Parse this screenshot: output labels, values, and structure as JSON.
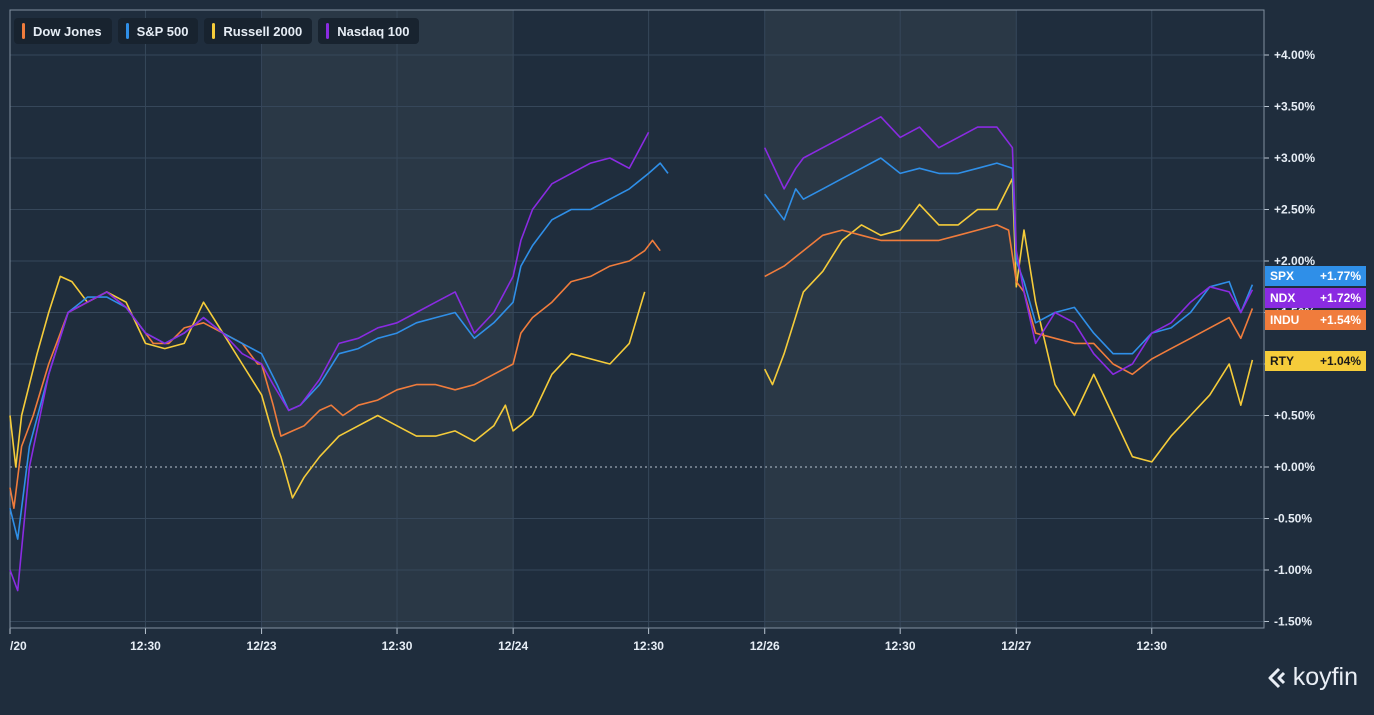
{
  "chart_data": {
    "type": "line",
    "title": "",
    "xlabel": "",
    "ylabel": "",
    "ylim": [
      -1.5,
      4.0
    ],
    "y_ticks": [
      "+4.00%",
      "+3.50%",
      "+3.00%",
      "+2.50%",
      "+2.00%",
      "+1.50%",
      "+1.00%",
      "+0.50%",
      "+0.00%",
      "-0.50%",
      "-1.00%",
      "-1.50%"
    ],
    "x_ticks": [
      "/20",
      "12:30",
      "12/23",
      "12:30",
      "12/24",
      "12:30",
      "12/26",
      "12:30",
      "12/27",
      "12:30"
    ],
    "grid": true,
    "zero_line": true,
    "legend_position": "top-left",
    "x_note": "x values are hours of trading since the start of the 12/20 session; sessions start at 0, 6.5, 13, 19.5, 26 (12/20, 12/23, 12/24, 12/26, 12/27)",
    "series": [
      {
        "name": "Dow Jones",
        "ticker": "INDU",
        "last": "+1.54%",
        "color": "#f07c3c",
        "points": [
          [
            0,
            -0.2
          ],
          [
            0.1,
            -0.4
          ],
          [
            0.3,
            0.2
          ],
          [
            0.6,
            0.5
          ],
          [
            1,
            1.0
          ],
          [
            1.5,
            1.5
          ],
          [
            2,
            1.6
          ],
          [
            2.5,
            1.7
          ],
          [
            3,
            1.55
          ],
          [
            3.3,
            1.4
          ],
          [
            3.7,
            1.2
          ],
          [
            4.1,
            1.2
          ],
          [
            4.5,
            1.35
          ],
          [
            5,
            1.4
          ],
          [
            5.5,
            1.3
          ],
          [
            6,
            1.2
          ],
          [
            6.4,
            1.0
          ],
          [
            6.5,
            1.0
          ],
          [
            6.8,
            0.6
          ],
          [
            7,
            0.3
          ],
          [
            7.3,
            0.35
          ],
          [
            7.6,
            0.4
          ],
          [
            8,
            0.55
          ],
          [
            8.3,
            0.6
          ],
          [
            8.6,
            0.5
          ],
          [
            9,
            0.6
          ],
          [
            9.5,
            0.65
          ],
          [
            10,
            0.75
          ],
          [
            10.5,
            0.8
          ],
          [
            11,
            0.8
          ],
          [
            11.5,
            0.75
          ],
          [
            12,
            0.8
          ],
          [
            12.5,
            0.9
          ],
          [
            13,
            1.0
          ],
          [
            13.2,
            1.3
          ],
          [
            13.5,
            1.45
          ],
          [
            14,
            1.6
          ],
          [
            14.5,
            1.8
          ],
          [
            15,
            1.85
          ],
          [
            15.5,
            1.95
          ],
          [
            16,
            2.0
          ],
          [
            16.4,
            2.1
          ],
          [
            16.6,
            2.2
          ],
          [
            16.8,
            2.1
          ],
          [
            19.5,
            2.1
          ],
          [
            19.5,
            1.85
          ],
          [
            20,
            1.95
          ],
          [
            20.5,
            2.1
          ],
          [
            21,
            2.25
          ],
          [
            21.5,
            2.3
          ],
          [
            22,
            2.25
          ],
          [
            22.5,
            2.2
          ],
          [
            23,
            2.2
          ],
          [
            23.5,
            2.2
          ],
          [
            24,
            2.2
          ],
          [
            24.5,
            2.25
          ],
          [
            25,
            2.3
          ],
          [
            25.5,
            2.35
          ],
          [
            25.8,
            2.3
          ],
          [
            26,
            1.8
          ],
          [
            26.2,
            1.7
          ],
          [
            26.5,
            1.3
          ],
          [
            27,
            1.25
          ],
          [
            27.5,
            1.2
          ],
          [
            28,
            1.2
          ],
          [
            28.5,
            1.0
          ],
          [
            29,
            0.9
          ],
          [
            29.5,
            1.05
          ],
          [
            30,
            1.15
          ],
          [
            30.5,
            1.25
          ],
          [
            31,
            1.35
          ],
          [
            31.5,
            1.45
          ],
          [
            31.8,
            1.25
          ],
          [
            32.1,
            1.54
          ]
        ]
      },
      {
        "name": "S&P 500",
        "ticker": "SPX",
        "last": "+1.77%",
        "color": "#2f8fe8",
        "points": [
          [
            0,
            -0.4
          ],
          [
            0.2,
            -0.7
          ],
          [
            0.5,
            0.2
          ],
          [
            1,
            0.9
          ],
          [
            1.5,
            1.5
          ],
          [
            2,
            1.65
          ],
          [
            2.5,
            1.65
          ],
          [
            3,
            1.55
          ],
          [
            3.5,
            1.3
          ],
          [
            4,
            1.2
          ],
          [
            4.5,
            1.3
          ],
          [
            5,
            1.45
          ],
          [
            5.5,
            1.3
          ],
          [
            6,
            1.2
          ],
          [
            6.5,
            1.1
          ],
          [
            6.9,
            0.8
          ],
          [
            7.2,
            0.55
          ],
          [
            7.5,
            0.6
          ],
          [
            8,
            0.8
          ],
          [
            8.5,
            1.1
          ],
          [
            9,
            1.15
          ],
          [
            9.5,
            1.25
          ],
          [
            10,
            1.3
          ],
          [
            10.5,
            1.4
          ],
          [
            11,
            1.45
          ],
          [
            11.5,
            1.5
          ],
          [
            12,
            1.25
          ],
          [
            12.5,
            1.4
          ],
          [
            13,
            1.6
          ],
          [
            13.2,
            1.95
          ],
          [
            13.5,
            2.15
          ],
          [
            14,
            2.4
          ],
          [
            14.5,
            2.5
          ],
          [
            15,
            2.5
          ],
          [
            15.5,
            2.6
          ],
          [
            16,
            2.7
          ],
          [
            16.5,
            2.85
          ],
          [
            16.8,
            2.95
          ],
          [
            17,
            2.85
          ],
          [
            19.5,
            2.85
          ],
          [
            19.5,
            2.65
          ],
          [
            20,
            2.4
          ],
          [
            20.3,
            2.7
          ],
          [
            20.5,
            2.6
          ],
          [
            21,
            2.7
          ],
          [
            21.5,
            2.8
          ],
          [
            22,
            2.9
          ],
          [
            22.5,
            3.0
          ],
          [
            23,
            2.85
          ],
          [
            23.5,
            2.9
          ],
          [
            24,
            2.85
          ],
          [
            24.5,
            2.85
          ],
          [
            25,
            2.9
          ],
          [
            25.5,
            2.95
          ],
          [
            25.9,
            2.9
          ],
          [
            26,
            2.0
          ],
          [
            26.2,
            1.8
          ],
          [
            26.5,
            1.4
          ],
          [
            27,
            1.5
          ],
          [
            27.5,
            1.55
          ],
          [
            28,
            1.3
          ],
          [
            28.5,
            1.1
          ],
          [
            29,
            1.1
          ],
          [
            29.5,
            1.3
          ],
          [
            30,
            1.35
          ],
          [
            30.5,
            1.5
          ],
          [
            31,
            1.75
          ],
          [
            31.5,
            1.8
          ],
          [
            31.8,
            1.5
          ],
          [
            32.1,
            1.77
          ]
        ]
      },
      {
        "name": "Russell 2000",
        "ticker": "RTY",
        "last": "+1.04%",
        "color": "#f5cc3a",
        "points": [
          [
            0,
            0.5
          ],
          [
            0.15,
            0.0
          ],
          [
            0.3,
            0.5
          ],
          [
            0.7,
            1.1
          ],
          [
            1,
            1.5
          ],
          [
            1.3,
            1.85
          ],
          [
            1.6,
            1.8
          ],
          [
            2,
            1.6
          ],
          [
            2.5,
            1.7
          ],
          [
            3,
            1.6
          ],
          [
            3.5,
            1.2
          ],
          [
            4,
            1.15
          ],
          [
            4.5,
            1.2
          ],
          [
            5,
            1.6
          ],
          [
            5.5,
            1.3
          ],
          [
            6,
            1.0
          ],
          [
            6.5,
            0.7
          ],
          [
            6.8,
            0.3
          ],
          [
            7,
            0.1
          ],
          [
            7.3,
            -0.3
          ],
          [
            7.6,
            -0.1
          ],
          [
            8,
            0.1
          ],
          [
            8.5,
            0.3
          ],
          [
            9,
            0.4
          ],
          [
            9.5,
            0.5
          ],
          [
            10,
            0.4
          ],
          [
            10.5,
            0.3
          ],
          [
            11,
            0.3
          ],
          [
            11.5,
            0.35
          ],
          [
            12,
            0.25
          ],
          [
            12.5,
            0.4
          ],
          [
            12.8,
            0.6
          ],
          [
            13,
            0.35
          ],
          [
            13.5,
            0.5
          ],
          [
            14,
            0.9
          ],
          [
            14.5,
            1.1
          ],
          [
            15,
            1.05
          ],
          [
            15.5,
            1.0
          ],
          [
            16,
            1.2
          ],
          [
            16.4,
            1.7
          ],
          [
            19.5,
            0.95
          ],
          [
            19.7,
            0.8
          ],
          [
            20,
            1.1
          ],
          [
            20.5,
            1.7
          ],
          [
            21,
            1.9
          ],
          [
            21.5,
            2.2
          ],
          [
            22,
            2.35
          ],
          [
            22.5,
            2.25
          ],
          [
            23,
            2.3
          ],
          [
            23.5,
            2.55
          ],
          [
            24,
            2.35
          ],
          [
            24.5,
            2.35
          ],
          [
            25,
            2.5
          ],
          [
            25.5,
            2.5
          ],
          [
            25.9,
            2.8
          ],
          [
            26,
            1.75
          ],
          [
            26.2,
            2.3
          ],
          [
            26.5,
            1.6
          ],
          [
            27,
            0.8
          ],
          [
            27.5,
            0.5
          ],
          [
            28,
            0.9
          ],
          [
            28.5,
            0.5
          ],
          [
            29,
            0.1
          ],
          [
            29.5,
            0.05
          ],
          [
            30,
            0.3
          ],
          [
            30.5,
            0.5
          ],
          [
            31,
            0.7
          ],
          [
            31.5,
            1.0
          ],
          [
            31.8,
            0.6
          ],
          [
            32.1,
            1.04
          ]
        ]
      },
      {
        "name": "Nasdaq 100",
        "ticker": "NDX",
        "last": "+1.72%",
        "color": "#8a2be2",
        "points": [
          [
            0,
            -1.0
          ],
          [
            0.2,
            -1.2
          ],
          [
            0.5,
            0.0
          ],
          [
            1,
            0.9
          ],
          [
            1.5,
            1.5
          ],
          [
            2,
            1.6
          ],
          [
            2.5,
            1.7
          ],
          [
            3,
            1.55
          ],
          [
            3.5,
            1.3
          ],
          [
            4,
            1.2
          ],
          [
            4.5,
            1.3
          ],
          [
            5,
            1.45
          ],
          [
            5.5,
            1.3
          ],
          [
            6,
            1.1
          ],
          [
            6.5,
            1.0
          ],
          [
            6.8,
            0.8
          ],
          [
            7.2,
            0.55
          ],
          [
            7.5,
            0.6
          ],
          [
            8,
            0.85
          ],
          [
            8.5,
            1.2
          ],
          [
            9,
            1.25
          ],
          [
            9.5,
            1.35
          ],
          [
            10,
            1.4
          ],
          [
            10.5,
            1.5
          ],
          [
            11,
            1.6
          ],
          [
            11.5,
            1.7
          ],
          [
            12,
            1.3
          ],
          [
            12.5,
            1.5
          ],
          [
            13,
            1.85
          ],
          [
            13.2,
            2.2
          ],
          [
            13.5,
            2.5
          ],
          [
            14,
            2.75
          ],
          [
            14.5,
            2.85
          ],
          [
            15,
            2.95
          ],
          [
            15.5,
            3.0
          ],
          [
            16,
            2.9
          ],
          [
            16.5,
            3.25
          ],
          [
            19.5,
            3.25
          ],
          [
            19.5,
            3.1
          ],
          [
            20,
            2.7
          ],
          [
            20.3,
            2.9
          ],
          [
            20.5,
            3.0
          ],
          [
            21,
            3.1
          ],
          [
            21.5,
            3.2
          ],
          [
            22,
            3.3
          ],
          [
            22.5,
            3.4
          ],
          [
            23,
            3.2
          ],
          [
            23.5,
            3.3
          ],
          [
            24,
            3.1
          ],
          [
            24.5,
            3.2
          ],
          [
            25,
            3.3
          ],
          [
            25.5,
            3.3
          ],
          [
            25.9,
            3.1
          ],
          [
            26,
            2.1
          ],
          [
            26.2,
            1.7
          ],
          [
            26.5,
            1.2
          ],
          [
            27,
            1.5
          ],
          [
            27.5,
            1.4
          ],
          [
            28,
            1.1
          ],
          [
            28.5,
            0.9
          ],
          [
            29,
            1.0
          ],
          [
            29.5,
            1.3
          ],
          [
            30,
            1.4
          ],
          [
            30.5,
            1.6
          ],
          [
            31,
            1.75
          ],
          [
            31.5,
            1.7
          ],
          [
            31.8,
            1.5
          ],
          [
            32.1,
            1.72
          ]
        ]
      }
    ]
  },
  "brand": {
    "text": "koyfin"
  }
}
